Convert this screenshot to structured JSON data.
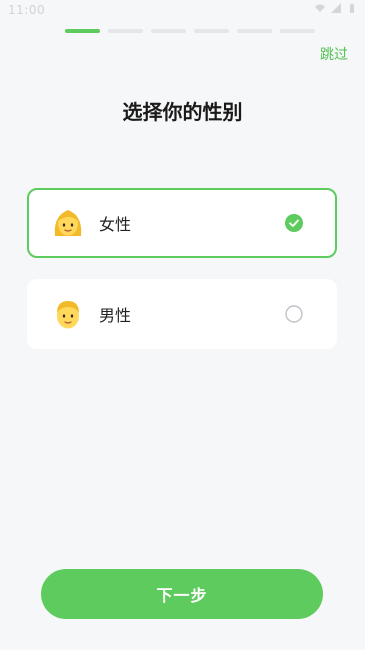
{
  "status_bar": {
    "time": "11:00",
    "icons": [
      "wifi-icon",
      "signal-icon",
      "battery-icon"
    ]
  },
  "progress": {
    "total_steps": 6,
    "current_step": 1
  },
  "header": {
    "skip_label": "跳过",
    "title": "选择你的性别"
  },
  "options": [
    {
      "label": "女性",
      "icon": "woman-emoji-icon",
      "selected": true
    },
    {
      "label": "男性",
      "icon": "man-emoji-icon",
      "selected": false
    }
  ],
  "footer": {
    "next_label": "下一步"
  },
  "colors": {
    "accent": "#5ecb5e",
    "background": "#f6f7f9",
    "card": "#ffffff",
    "inactive_step": "#e4e6ea"
  }
}
